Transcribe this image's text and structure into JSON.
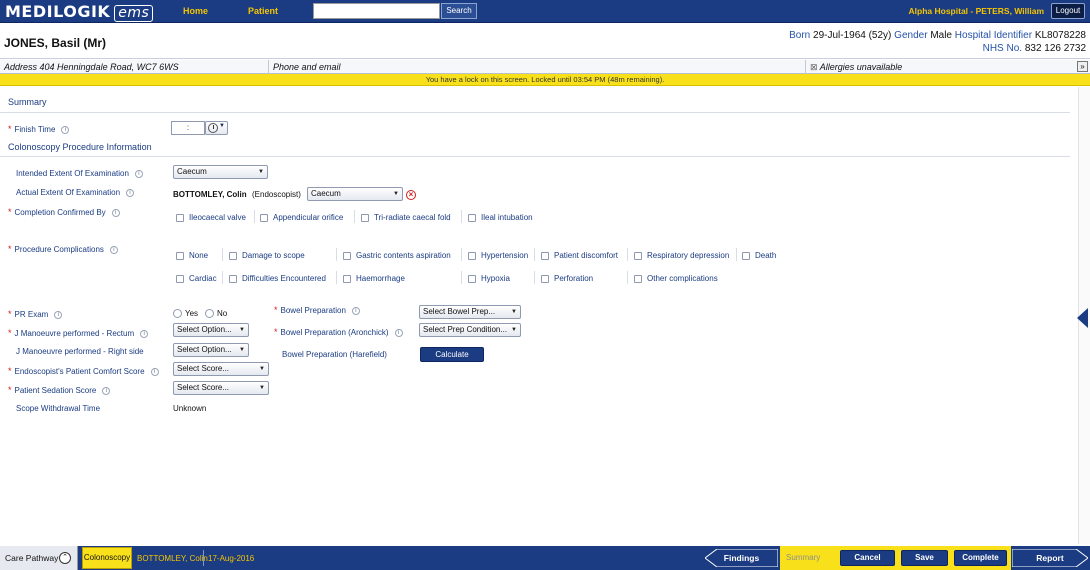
{
  "app": {
    "logo_main": "MEDILOGIK",
    "logo_sub": "ems",
    "nav": [
      "Home",
      "Patient"
    ],
    "search_button": "Search",
    "hospital_user": "Alpha Hospital  -  PETERS, William",
    "logout": "Logout"
  },
  "patient": {
    "name": "JONES, Basil (Mr)",
    "born_label": "Born",
    "born_value": "29-Jul-1964 (52y)",
    "gender_label": "Gender",
    "gender_value": "Male",
    "hosp_id_label": "Hospital Identifier",
    "hosp_id_value": "KL8078228",
    "nhs_label": "NHS No.",
    "nhs_value": "832 126 2732",
    "address": "Address 404 Henningdale Road, WC7 6WS",
    "phone_email": "Phone and email",
    "allergies": "Allergies unavailable"
  },
  "lock_message": "You have a lock on this screen. Locked until 03:54 PM (48m remaining).",
  "form": {
    "summary_title": "Summary",
    "finish_time_label": "Finish Time",
    "finish_time_value": ":",
    "procedure_section": "Colonoscopy Procedure Information",
    "intended_label": "Intended Extent Of Examination",
    "intended_value": "Caecum",
    "actual_label": "Actual Extent Of Examination",
    "actual_endoscopist": "BOTTOMLEY, Colin",
    "actual_role": "(Endoscopist)",
    "actual_value": "Caecum",
    "completion_label": "Completion Confirmed By",
    "completion_options": [
      "Ileocaecal valve",
      "Appendicular orifice",
      "Tri-radiate caecal fold",
      "Ileal intubation"
    ],
    "complications_label": "Procedure Complications",
    "complications_row1": [
      "None",
      "Damage to scope",
      "Gastric contents aspiration",
      "Hypertension",
      "Patient discomfort",
      "Respiratory depression",
      "Death"
    ],
    "complications_row2": [
      "Cardiac",
      "Difficulties Encountered",
      "Haemorrhage",
      "Hypoxia",
      "Perforation",
      "Other complications"
    ],
    "pr_exam_label": "PR Exam",
    "pr_yes": "Yes",
    "pr_no": "No",
    "j_rectum_label": "J Manoeuvre performed - Rectum",
    "j_rectum_value": "Select Option...",
    "j_right_label": "J Manoeuvre performed - Right side",
    "j_right_value": "Select Option...",
    "comfort_label": "Endoscopist's Patient Comfort Score",
    "comfort_value": "Select Score...",
    "sedation_label": "Patient Sedation Score",
    "sedation_value": "Select Score...",
    "withdrawal_label": "Scope Withdrawal Time",
    "withdrawal_value": "Unknown",
    "bowel_prep_label": "Bowel Preparation",
    "bowel_prep_value": "Select Bowel Prep...",
    "aronchick_label": "Bowel Preparation (Aronchick)",
    "aronchick_value": "Select Prep Condition...",
    "harefield_label": "Bowel Preparation (Harefield)",
    "calculate": "Calculate"
  },
  "bottom": {
    "care_pathway": "Care Pathway",
    "tab": "Colonoscopy",
    "endoscopist": "BOTTOMLEY, Colin",
    "date": "17-Aug-2016",
    "findings": "Findings",
    "summary": "Summary",
    "cancel": "Cancel",
    "save": "Save",
    "complete": "Complete",
    "report": "Report"
  },
  "colors": {
    "brand_blue": "#1b3c82",
    "nav_yellow": "#f5c400",
    "banner_yellow": "#f8e11b",
    "required_red": "#d01c1c"
  }
}
